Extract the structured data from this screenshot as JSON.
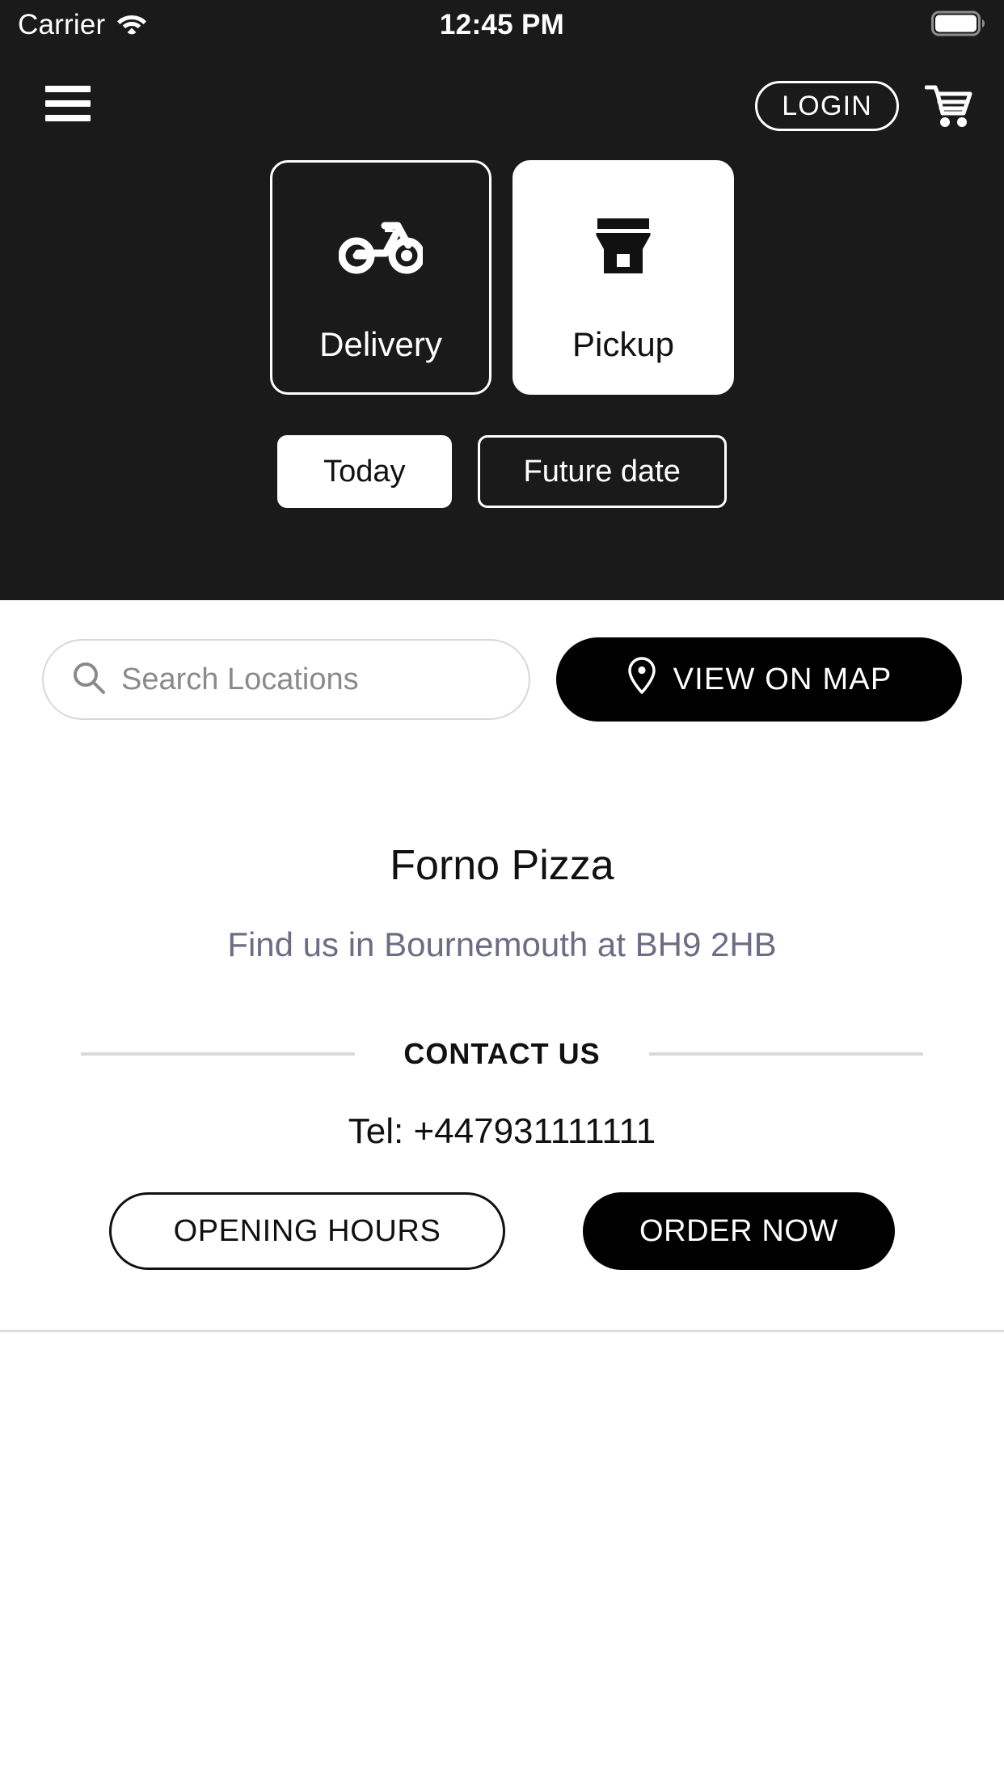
{
  "status_bar": {
    "carrier": "Carrier",
    "wifi_icon": "wifi-icon",
    "time": "12:45 PM",
    "battery_icon": "battery-full-icon"
  },
  "nav": {
    "menu_icon": "hamburger-menu-icon",
    "login_label": "LOGIN",
    "cart_icon": "shopping-cart-icon"
  },
  "order_mode": {
    "options": [
      {
        "label": "Delivery",
        "icon": "scooter-icon",
        "selected": false
      },
      {
        "label": "Pickup",
        "icon": "storefront-icon",
        "selected": true
      }
    ]
  },
  "when": {
    "options": [
      {
        "label": "Today",
        "selected": true
      },
      {
        "label": "Future date",
        "selected": false
      }
    ]
  },
  "search": {
    "placeholder": "Search Locations",
    "value": "",
    "icon": "search-icon"
  },
  "map_button": {
    "label": "VIEW ON MAP",
    "icon": "map-pin-icon"
  },
  "store": {
    "name": "Forno Pizza",
    "address_line": "Find us in Bournemouth at BH9 2HB",
    "contact_heading": "CONTACT US",
    "telephone": "Tel: +447931111111"
  },
  "actions": {
    "opening_hours_label": "OPENING HOURS",
    "order_now_label": "ORDER NOW"
  },
  "colors": {
    "header_bg": "#1a1a1a",
    "page_bg": "#ffffff",
    "accent_black": "#000000",
    "muted_text": "#6c6c84",
    "divider": "#dcdcdc",
    "placeholder": "#8a8a8a"
  }
}
